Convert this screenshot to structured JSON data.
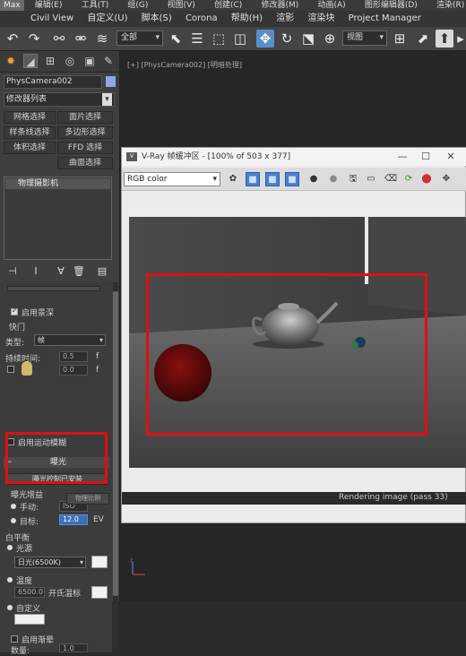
{
  "menubar_top": {
    "logo": "Max",
    "items": [
      "编辑(E)",
      "工具(T)",
      "组(G)",
      "视图(V)",
      "创建(C)",
      "修改器(M)",
      "动画(A)",
      "图形编辑器(D)",
      "渲染(R)"
    ]
  },
  "menubar": {
    "items": [
      "Civil View",
      "自定义(U)",
      "脚本(S)",
      "Corona",
      "帮助(H)",
      "渲影",
      "渲染块",
      "Project Manager"
    ]
  },
  "toolbar": {
    "selection_filter": "全部",
    "view_combo": "视图"
  },
  "command_panel": {
    "object_name": "PhysCamera002",
    "object_color": "#8fa5e8",
    "modifier_list": "修改器列表",
    "modifier_buttons": [
      "网格选择",
      "面片选择",
      "样条线选择",
      "多边形选择",
      "体积选择",
      "FFD 选择",
      "曲面选择"
    ],
    "stack_item": "物理摄影机",
    "enable_dof_label": "启用景深",
    "shutter_section": "快门",
    "type_label": "类型:",
    "type_value": "帧",
    "duration_label": "持续时间:",
    "duration_value": "0.5",
    "duration_unit": "f",
    "offset_value": "0.0",
    "offset_unit": "f",
    "motion_blur_label": "启用运动模糊",
    "exposure_header": "曝光",
    "exposure_control_button": "曝光控制已安装",
    "exposure_gain_label": "曝光增益",
    "manual_label": "手动:",
    "manual_value": "ISO",
    "target_label": "目标:",
    "target_value": "12.0",
    "target_unit": "EV",
    "physical_scale_btn": "物理比例",
    "white_balance_label": "白平衡",
    "illuminant_label": "光源",
    "illuminant_value": "日光(6500K)",
    "temperature_label": "温度",
    "temperature_value": "6500.0",
    "kelvin_label": "开氏温标",
    "custom_label": "自定义",
    "vignette_label": "启用渐晕",
    "amount_label": "数量:",
    "amount_value": "1.0"
  },
  "viewport": {
    "label": "[+] [PhysCamera002] [明暗处理]"
  },
  "vfb": {
    "title": "V-Ray 帧缓冲区 - [100% of 503 x 377]",
    "channel": "RGB color",
    "status": "Rendering image (pass 33)"
  }
}
